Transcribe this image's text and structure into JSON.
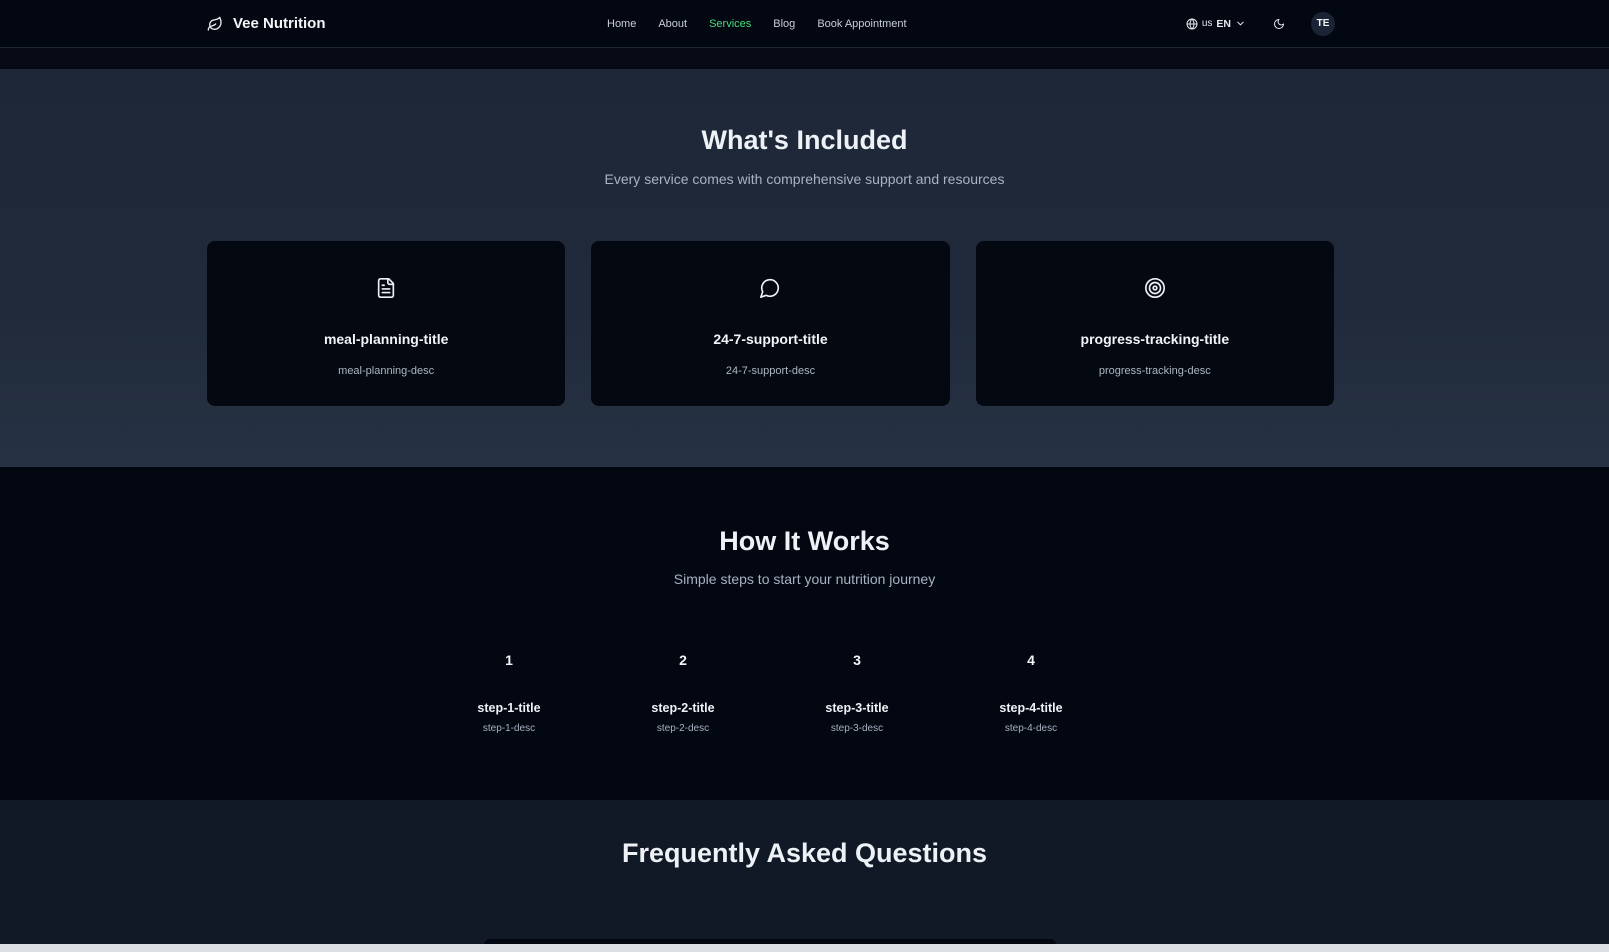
{
  "nav": {
    "brand": "Vee Nutrition",
    "links": [
      {
        "label": "Home",
        "active": false
      },
      {
        "label": "About",
        "active": false
      },
      {
        "label": "Services",
        "active": true
      },
      {
        "label": "Blog",
        "active": false
      },
      {
        "label": "Book Appointment",
        "active": false
      }
    ],
    "lang_flag": "us",
    "lang_code": "EN",
    "avatar_initials": "TE"
  },
  "included": {
    "title": "What's Included",
    "subtitle": "Every service comes with comprehensive support and resources",
    "cards": [
      {
        "icon": "document-icon",
        "title": "meal-planning-title",
        "desc": "meal-planning-desc"
      },
      {
        "icon": "chat-bubble-icon",
        "title": "24-7-support-title",
        "desc": "24-7-support-desc"
      },
      {
        "icon": "target-icon",
        "title": "progress-tracking-title",
        "desc": "progress-tracking-desc"
      }
    ]
  },
  "how": {
    "title": "How It Works",
    "subtitle": "Simple steps to start your nutrition journey",
    "steps": [
      {
        "num": "1",
        "title": "step-1-title",
        "desc": "step-1-desc"
      },
      {
        "num": "2",
        "title": "step-2-title",
        "desc": "step-2-desc"
      },
      {
        "num": "3",
        "title": "step-3-title",
        "desc": "step-3-desc"
      },
      {
        "num": "4",
        "title": "step-4-title",
        "desc": "step-4-desc"
      }
    ]
  },
  "faq": {
    "title": "Frequently Asked Questions"
  },
  "colors": {
    "accent": "#4ade80",
    "nav_bg": "#030711",
    "card_bg": "#040811"
  }
}
